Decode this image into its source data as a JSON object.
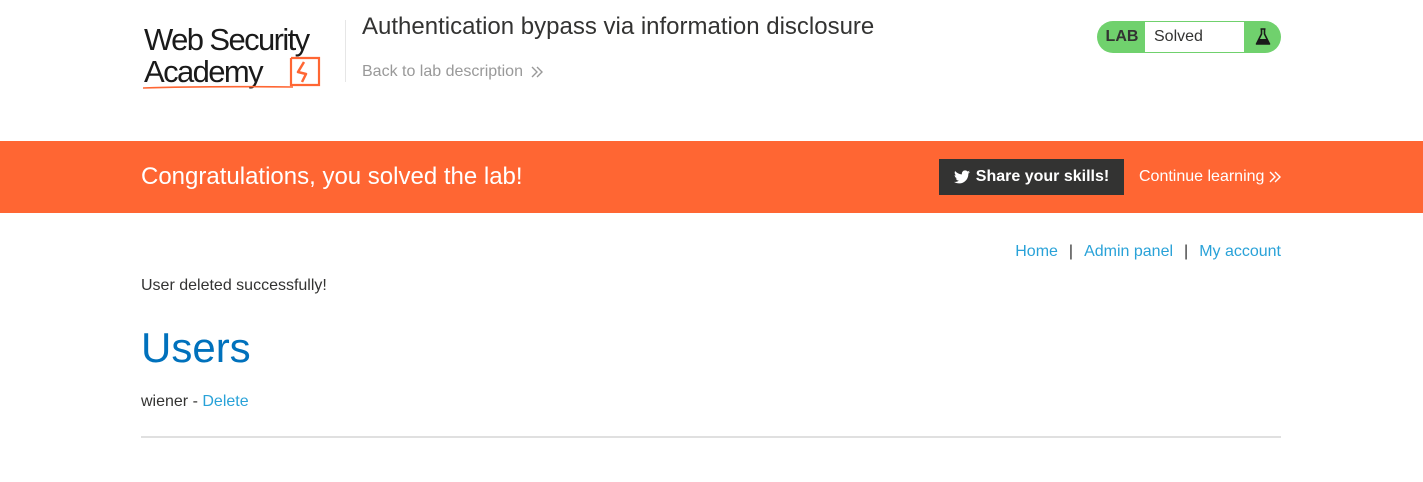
{
  "header": {
    "logo_text": "Web Security Academy",
    "lab_title": "Authentication bypass via information disclosure",
    "back_link": "Back to lab description",
    "status": {
      "tag": "LAB",
      "value": "Solved",
      "icon": "flask-icon",
      "color": "#70d16d"
    }
  },
  "banner": {
    "message": "Congratulations, you solved the lab!",
    "share_label": "Share your skills!",
    "share_icon": "twitter-icon",
    "continue_label": "Continue learning",
    "color": "#ff6633"
  },
  "nav": {
    "items": [
      {
        "label": "Home"
      },
      {
        "label": "Admin panel"
      },
      {
        "label": "My account"
      }
    ],
    "separator": "|"
  },
  "main": {
    "message": "User deleted successfully!",
    "heading": "Users",
    "users": [
      {
        "name": "wiener",
        "separator": " - ",
        "action": "Delete"
      }
    ]
  },
  "colors": {
    "link": "#29a2d8",
    "heading": "#0071bc",
    "text": "#333332"
  }
}
